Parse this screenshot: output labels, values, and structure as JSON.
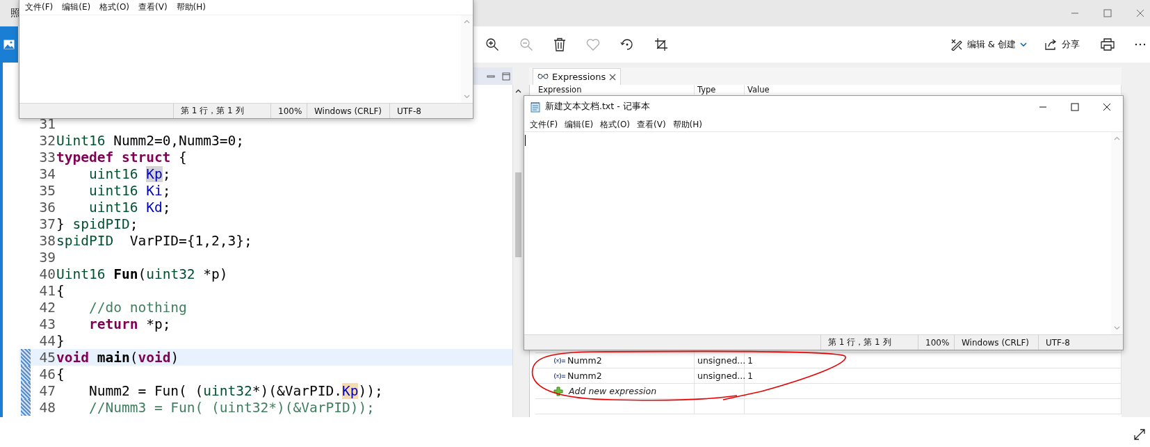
{
  "photos": {
    "title": "照",
    "actions": [
      {
        "label": "编辑 & 创建",
        "kind": "edit"
      },
      {
        "label": "分享",
        "kind": "share"
      }
    ]
  },
  "notepad_back": {
    "menu": [
      "文件(F)",
      "编辑(E)",
      "格式(O)",
      "查看(V)",
      "帮助(H)"
    ],
    "status": [
      "第 1 行，第 1 列",
      "100%",
      "Windows (CRLF)",
      "UTF-8"
    ]
  },
  "editor": {
    "lines": [
      {
        "number": "31",
        "selected": false,
        "changed": false
      },
      {
        "number": "32",
        "selected": false,
        "changed": false,
        "tokens": [
          {
            "t": "Uint16",
            "kind": "type"
          },
          {
            "t": " Numm2=0,Numm3=0;",
            "kind": "plain"
          }
        ]
      },
      {
        "number": "33",
        "selected": false,
        "changed": false,
        "tokens": [
          {
            "t": "typedef struct",
            "kind": "keyword"
          },
          {
            "t": " {",
            "kind": "plain"
          }
        ]
      },
      {
        "number": "34",
        "selected": false,
        "changed": false,
        "tokens": [
          {
            "t": "    uint16 ",
            "kind": "type"
          },
          {
            "t": "Kp",
            "kind": "field",
            "marked": true,
            "write": false
          },
          {
            "t": ";",
            "kind": "plain"
          }
        ]
      },
      {
        "number": "35",
        "selected": false,
        "changed": false,
        "tokens": [
          {
            "t": "    uint16 ",
            "kind": "type"
          },
          {
            "t": "Ki",
            "kind": "field"
          },
          {
            "t": ";",
            "kind": "plain"
          }
        ]
      },
      {
        "number": "36",
        "selected": false,
        "changed": false,
        "tokens": [
          {
            "t": "    uint16 ",
            "kind": "type"
          },
          {
            "t": "Kd",
            "kind": "field"
          },
          {
            "t": ";",
            "kind": "plain"
          }
        ]
      },
      {
        "number": "37",
        "selected": false,
        "changed": false,
        "tokens": [
          {
            "t": "} ",
            "kind": "plain"
          },
          {
            "t": "spidPID",
            "kind": "type"
          },
          {
            "t": ";",
            "kind": "plain"
          }
        ]
      },
      {
        "number": "38",
        "selected": false,
        "changed": false,
        "tokens": [
          {
            "t": "spidPID",
            "kind": "type"
          },
          {
            "t": "  VarPID={1,2,3};",
            "kind": "plain"
          }
        ]
      },
      {
        "number": "39",
        "selected": false,
        "changed": false
      },
      {
        "number": "40",
        "selected": false,
        "changed": false,
        "tokens": [
          {
            "t": "Uint16 ",
            "kind": "type"
          },
          {
            "t": "Fun",
            "kind": "func"
          },
          {
            "t": "(",
            "kind": "plain"
          },
          {
            "t": "uint32",
            "kind": "type"
          },
          {
            "t": " *p)",
            "kind": "plain"
          }
        ]
      },
      {
        "number": "41",
        "selected": false,
        "changed": false,
        "tokens": [
          {
            "t": "{",
            "kind": "plain"
          }
        ]
      },
      {
        "number": "42",
        "selected": false,
        "changed": false,
        "tokens": [
          {
            "t": "    //do nothing",
            "kind": "comment"
          }
        ]
      },
      {
        "number": "43",
        "selected": false,
        "changed": false,
        "tokens": [
          {
            "t": "    return",
            "kind": "keyword"
          },
          {
            "t": " *p;",
            "kind": "plain"
          }
        ]
      },
      {
        "number": "44",
        "selected": false,
        "changed": false,
        "tokens": [
          {
            "t": "}",
            "kind": "plain"
          }
        ]
      },
      {
        "number": "45",
        "selected": true,
        "changed": true,
        "tokens": [
          {
            "t": "void",
            "kind": "keyword"
          },
          {
            "t": " main",
            "kind": "func"
          },
          {
            "t": "(",
            "kind": "plain"
          },
          {
            "t": "void",
            "kind": "keyword"
          },
          {
            "t": ")",
            "kind": "plain"
          }
        ]
      },
      {
        "number": "46",
        "selected": false,
        "changed": true,
        "tokens": [
          {
            "t": "{",
            "kind": "plain"
          }
        ]
      },
      {
        "number": "47",
        "selected": false,
        "changed": true,
        "tokens": [
          {
            "t": "    Numm2 = Fun( (",
            "kind": "plain"
          },
          {
            "t": "uint32",
            "kind": "type"
          },
          {
            "t": "*)(&VarPID.",
            "kind": "plain"
          },
          {
            "t": "Kp",
            "kind": "field",
            "marked": true,
            "write": true
          },
          {
            "t": "));",
            "kind": "plain"
          }
        ]
      },
      {
        "number": "48",
        "selected": false,
        "changed": true,
        "tokens": [
          {
            "t": "    //Numm3 = Fun( (uint32*)(&VarPID));",
            "kind": "comment"
          }
        ]
      }
    ]
  },
  "expressions": {
    "tab": "Expressions",
    "columns": [
      "Expression",
      "Type",
      "Value"
    ],
    "rows": [
      {
        "name": "Numm2",
        "type": "unsigned...",
        "value": "1"
      },
      {
        "name": "Numm2",
        "type": "unsigned...",
        "value": "1"
      }
    ],
    "add_label": "Add new expression"
  },
  "notepad_front": {
    "title": "新建文本文档.txt - 记事本",
    "menu": [
      "文件(F)",
      "编辑(E)",
      "格式(O)",
      "查看(V)",
      "帮助(H)"
    ],
    "status": [
      "第 1 行，第 1 列",
      "100%",
      "Windows (CRLF)",
      "UTF-8"
    ]
  }
}
